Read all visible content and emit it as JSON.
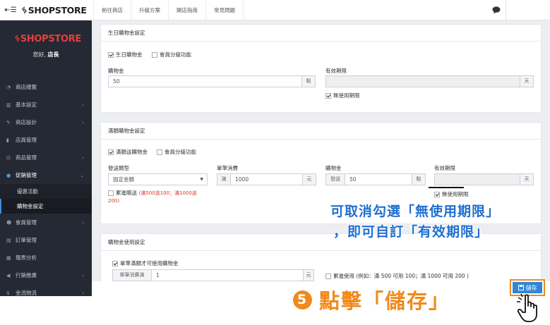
{
  "topbar": {
    "menu_icon": "☰",
    "logo": "SHOPSTORE",
    "nav": [
      "前往商店",
      "升級方案",
      "開店指南",
      "常見問題"
    ]
  },
  "sidebar": {
    "logo": "SHOPSTORE",
    "greeting_prefix": "您好, ",
    "greeting_name": "店長",
    "items": [
      {
        "label": "商店總覽",
        "icon": "dashboard-icon",
        "chev": false
      },
      {
        "label": "基本設定",
        "icon": "bank-icon",
        "chev": true
      },
      {
        "label": "商店設計",
        "icon": "brush-icon",
        "chev": true
      },
      {
        "label": "店員管理",
        "icon": "staff-icon",
        "chev": false
      },
      {
        "label": "商品管理",
        "icon": "cart-icon",
        "chev": true
      },
      {
        "label": "促銷管理",
        "icon": "info-icon",
        "chev": true,
        "active": true
      }
    ],
    "subitems": [
      "優惠活動",
      "購物金設定"
    ],
    "items_after": [
      {
        "label": "會員管理",
        "icon": "users-icon",
        "chev": true
      },
      {
        "label": "訂單管理",
        "icon": "order-icon",
        "chev": false
      },
      {
        "label": "報表分析",
        "icon": "chart-icon",
        "chev": false
      },
      {
        "label": "行銷推廣",
        "icon": "megaphone-icon",
        "chev": true
      },
      {
        "label": "金流物流",
        "icon": "dollar-icon",
        "chev": true
      }
    ]
  },
  "birthday": {
    "title": "生日購物金設定",
    "enable_label": "生日購物金",
    "tier_label": "會員分級功能",
    "amount_label": "購物金",
    "amount_value": "50",
    "amount_unit": "點",
    "expiry_label": "有效期限",
    "expiry_unit": "天",
    "no_expiry_label": "無使用期限"
  },
  "threshold": {
    "title": "滿額購物金設定",
    "enable_label": "滿額送購物金",
    "tier_label": "會員分級功能",
    "type_label": "發送類型",
    "type_value": "固定金額",
    "cumulative_label": "累進贈送",
    "cumulative_note_1": "(滿500送100；滿1000送",
    "cumulative_note_2": "200)",
    "single_label": "單筆消費",
    "single_prefix": "滿",
    "single_value": "1000",
    "single_unit": "元",
    "amount_label": "購物金",
    "amount_prefix": "發送",
    "amount_value": "50",
    "amount_unit": "點",
    "expiry_label": "有效期限",
    "expiry_unit": "天",
    "no_expiry_label": "無使用期限"
  },
  "usage": {
    "title": "購物金使用設定",
    "min_label": "單筆滿額才可使用購物金",
    "min_prefix": "單筆消費滿",
    "min_value": "1",
    "min_unit": "元",
    "cumulative_label": "累進使用 (例如：滿 500 可用 100；滿 1000 可用 200 )"
  },
  "annotations": {
    "line1": "可取消勾選「無使用期限」",
    "line2": "，即可自訂「有效期限」",
    "step_number": "5",
    "step_text": "點擊「儲存」"
  },
  "save_button": {
    "label": "儲存"
  },
  "colors": {
    "accent": "#2f86d8",
    "annotation_blue": "#1f6fd1",
    "annotation_orange": "#f08a1c",
    "sidebar_bg": "#252933"
  }
}
